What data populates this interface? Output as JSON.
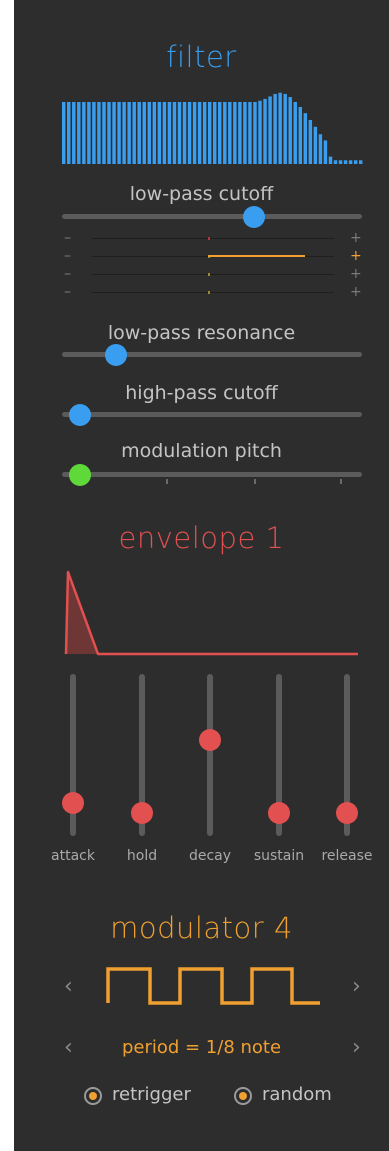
{
  "filter": {
    "title": "filter",
    "spectrum_levels": [
      1,
      1,
      1,
      1,
      1,
      1,
      1,
      1,
      1,
      1,
      1,
      1,
      1,
      1,
      1,
      1,
      1,
      1,
      1,
      1,
      1,
      1,
      1,
      1,
      1,
      1,
      1,
      1,
      1,
      1,
      1,
      1,
      1,
      1,
      1,
      1,
      1,
      1,
      1,
      1.02,
      1.05,
      1.09,
      1.13,
      1.15,
      1.13,
      1.08,
      1.0,
      0.92,
      0.82,
      0.71,
      0.6,
      0.48,
      0.38,
      0.12,
      0.06,
      0.06,
      0.06,
      0.06,
      0.06,
      0.06
    ],
    "lowpass_cutoff": {
      "label": "low-pass cutoff",
      "value": 0.64
    },
    "mod_rows": [
      {
        "minus": "–",
        "plus": "+",
        "center": 0.48,
        "amount": 0.0
      },
      {
        "minus": "–",
        "plus": "+",
        "center": 0.48,
        "amount": 0.4
      },
      {
        "minus": "–",
        "plus": "+",
        "center": 0.48,
        "amount": 0.0
      },
      {
        "minus": "–",
        "plus": "+",
        "center": 0.48,
        "amount": 0.0
      }
    ],
    "lowpass_resonance": {
      "label": "low-pass resonance",
      "value": 0.18
    },
    "highpass_cutoff": {
      "label": "high-pass cutoff",
      "value": 0.06
    },
    "modulation_pitch": {
      "label": "modulation pitch",
      "value": 0.06
    }
  },
  "envelope": {
    "title": "envelope 1",
    "sliders": [
      {
        "label": "attack",
        "value": 0.18
      },
      {
        "label": "hold",
        "value": 0.12
      },
      {
        "label": "decay",
        "value": 0.57
      },
      {
        "label": "sustain",
        "value": 0.12
      },
      {
        "label": "release",
        "value": 0.12
      }
    ]
  },
  "modulator": {
    "title": "modulator 4",
    "prev_arrow": "‹",
    "next_arrow": "›",
    "period_text": "period = 1/8 note",
    "retrigger_label": "retrigger",
    "random_label": "random"
  },
  "colors": {
    "filter_accent": "#3a9ef0",
    "envelope_accent": "#e25050",
    "modulator_accent": "#f0a030",
    "pitch_knob": "#5fd83a"
  }
}
